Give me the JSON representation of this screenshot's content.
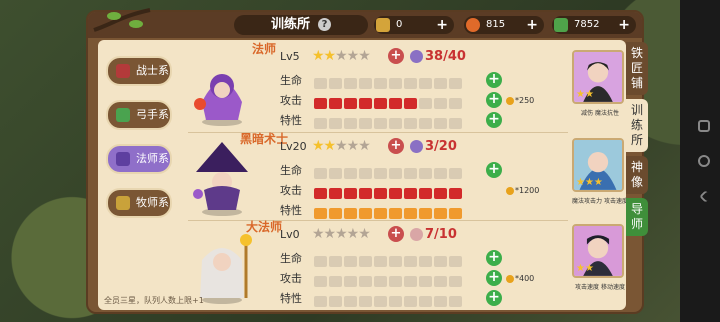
{
  "header": {
    "title": "训练所",
    "help": "?"
  },
  "resources": [
    {
      "name": "gold-bar",
      "value": "0"
    },
    {
      "name": "bread",
      "value": "815"
    },
    {
      "name": "book",
      "value": "7852"
    }
  ],
  "categories": [
    {
      "label": "战士系",
      "active": false
    },
    {
      "label": "弓手系",
      "active": false
    },
    {
      "label": "法师系",
      "active": true
    },
    {
      "label": "牧师系",
      "active": false
    }
  ],
  "side_tabs": [
    "铁匠铺",
    "训练所",
    "神像",
    "导师"
  ],
  "units": [
    {
      "name": "法师",
      "level": "Lv5",
      "stars": 2,
      "fragments": "38/40",
      "stats": [
        {
          "label": "生命",
          "filled": 0,
          "color": "red"
        },
        {
          "label": "攻击",
          "filled": 7,
          "color": "red"
        },
        {
          "label": "特性",
          "filled": 0,
          "color": "red"
        }
      ],
      "cost": "*250",
      "card_stars": 2,
      "card_label": "减伤    魔法抗性"
    },
    {
      "name": "黑暗术士",
      "level": "Lv20",
      "stars": 2,
      "fragments": "3/20",
      "stats": [
        {
          "label": "生命",
          "filled": 0,
          "color": "red"
        },
        {
          "label": "攻击",
          "filled": 10,
          "color": "red"
        },
        {
          "label": "特性",
          "filled": 10,
          "color": "orange"
        }
      ],
      "cost": "*1200",
      "card_stars": 3,
      "card_label": "魔法攻击力    攻击速度"
    },
    {
      "name": "大法师",
      "level": "Lv0",
      "stars": 0,
      "fragments": "7/10",
      "stats": [
        {
          "label": "生命",
          "filled": 0,
          "color": "red"
        },
        {
          "label": "攻击",
          "filled": 0,
          "color": "red"
        },
        {
          "label": "特性",
          "filled": 0,
          "color": "red"
        }
      ],
      "cost": "*400",
      "card_stars": 2,
      "card_label": "攻击速度    移动速度"
    }
  ],
  "footer": "全员三星，队列人数上限+1"
}
